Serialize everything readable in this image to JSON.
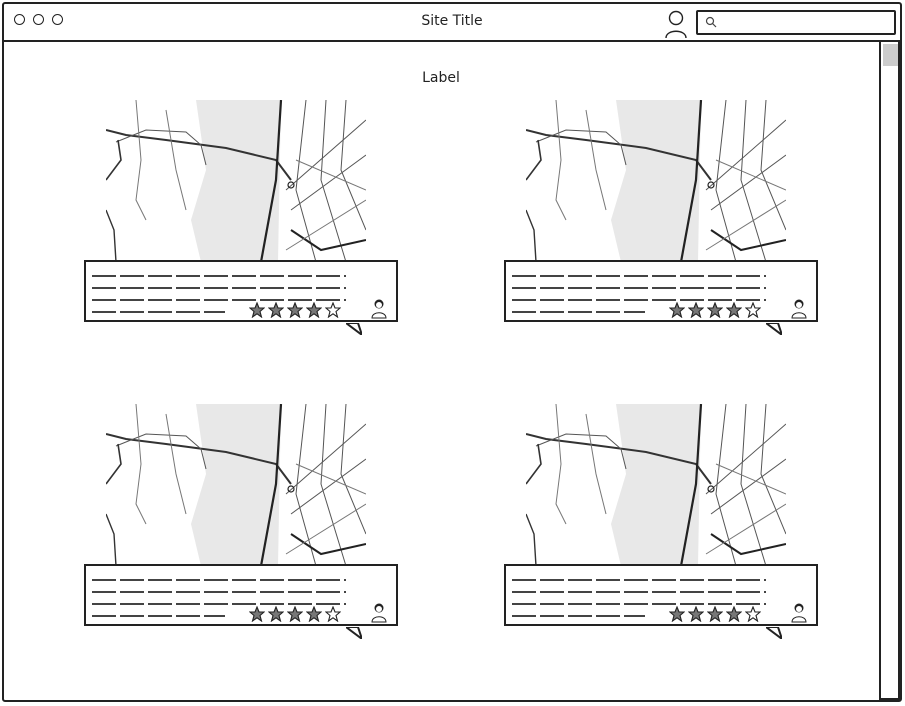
{
  "window": {
    "title": "Site Title"
  },
  "search": {
    "placeholder": ""
  },
  "content": {
    "label": "Label"
  },
  "cards": [
    {
      "rating": 4,
      "max_rating": 5
    },
    {
      "rating": 4,
      "max_rating": 5
    },
    {
      "rating": 4,
      "max_rating": 5
    },
    {
      "rating": 4,
      "max_rating": 5
    }
  ],
  "icons": {
    "window_dots": "circle-icon",
    "user": "user-icon",
    "search": "search-icon",
    "reviewer": "person-icon",
    "rating": "star-icon"
  },
  "colors": {
    "stroke": "#222222",
    "star_fill": "#777777",
    "map_water": "#e8e8e8"
  }
}
